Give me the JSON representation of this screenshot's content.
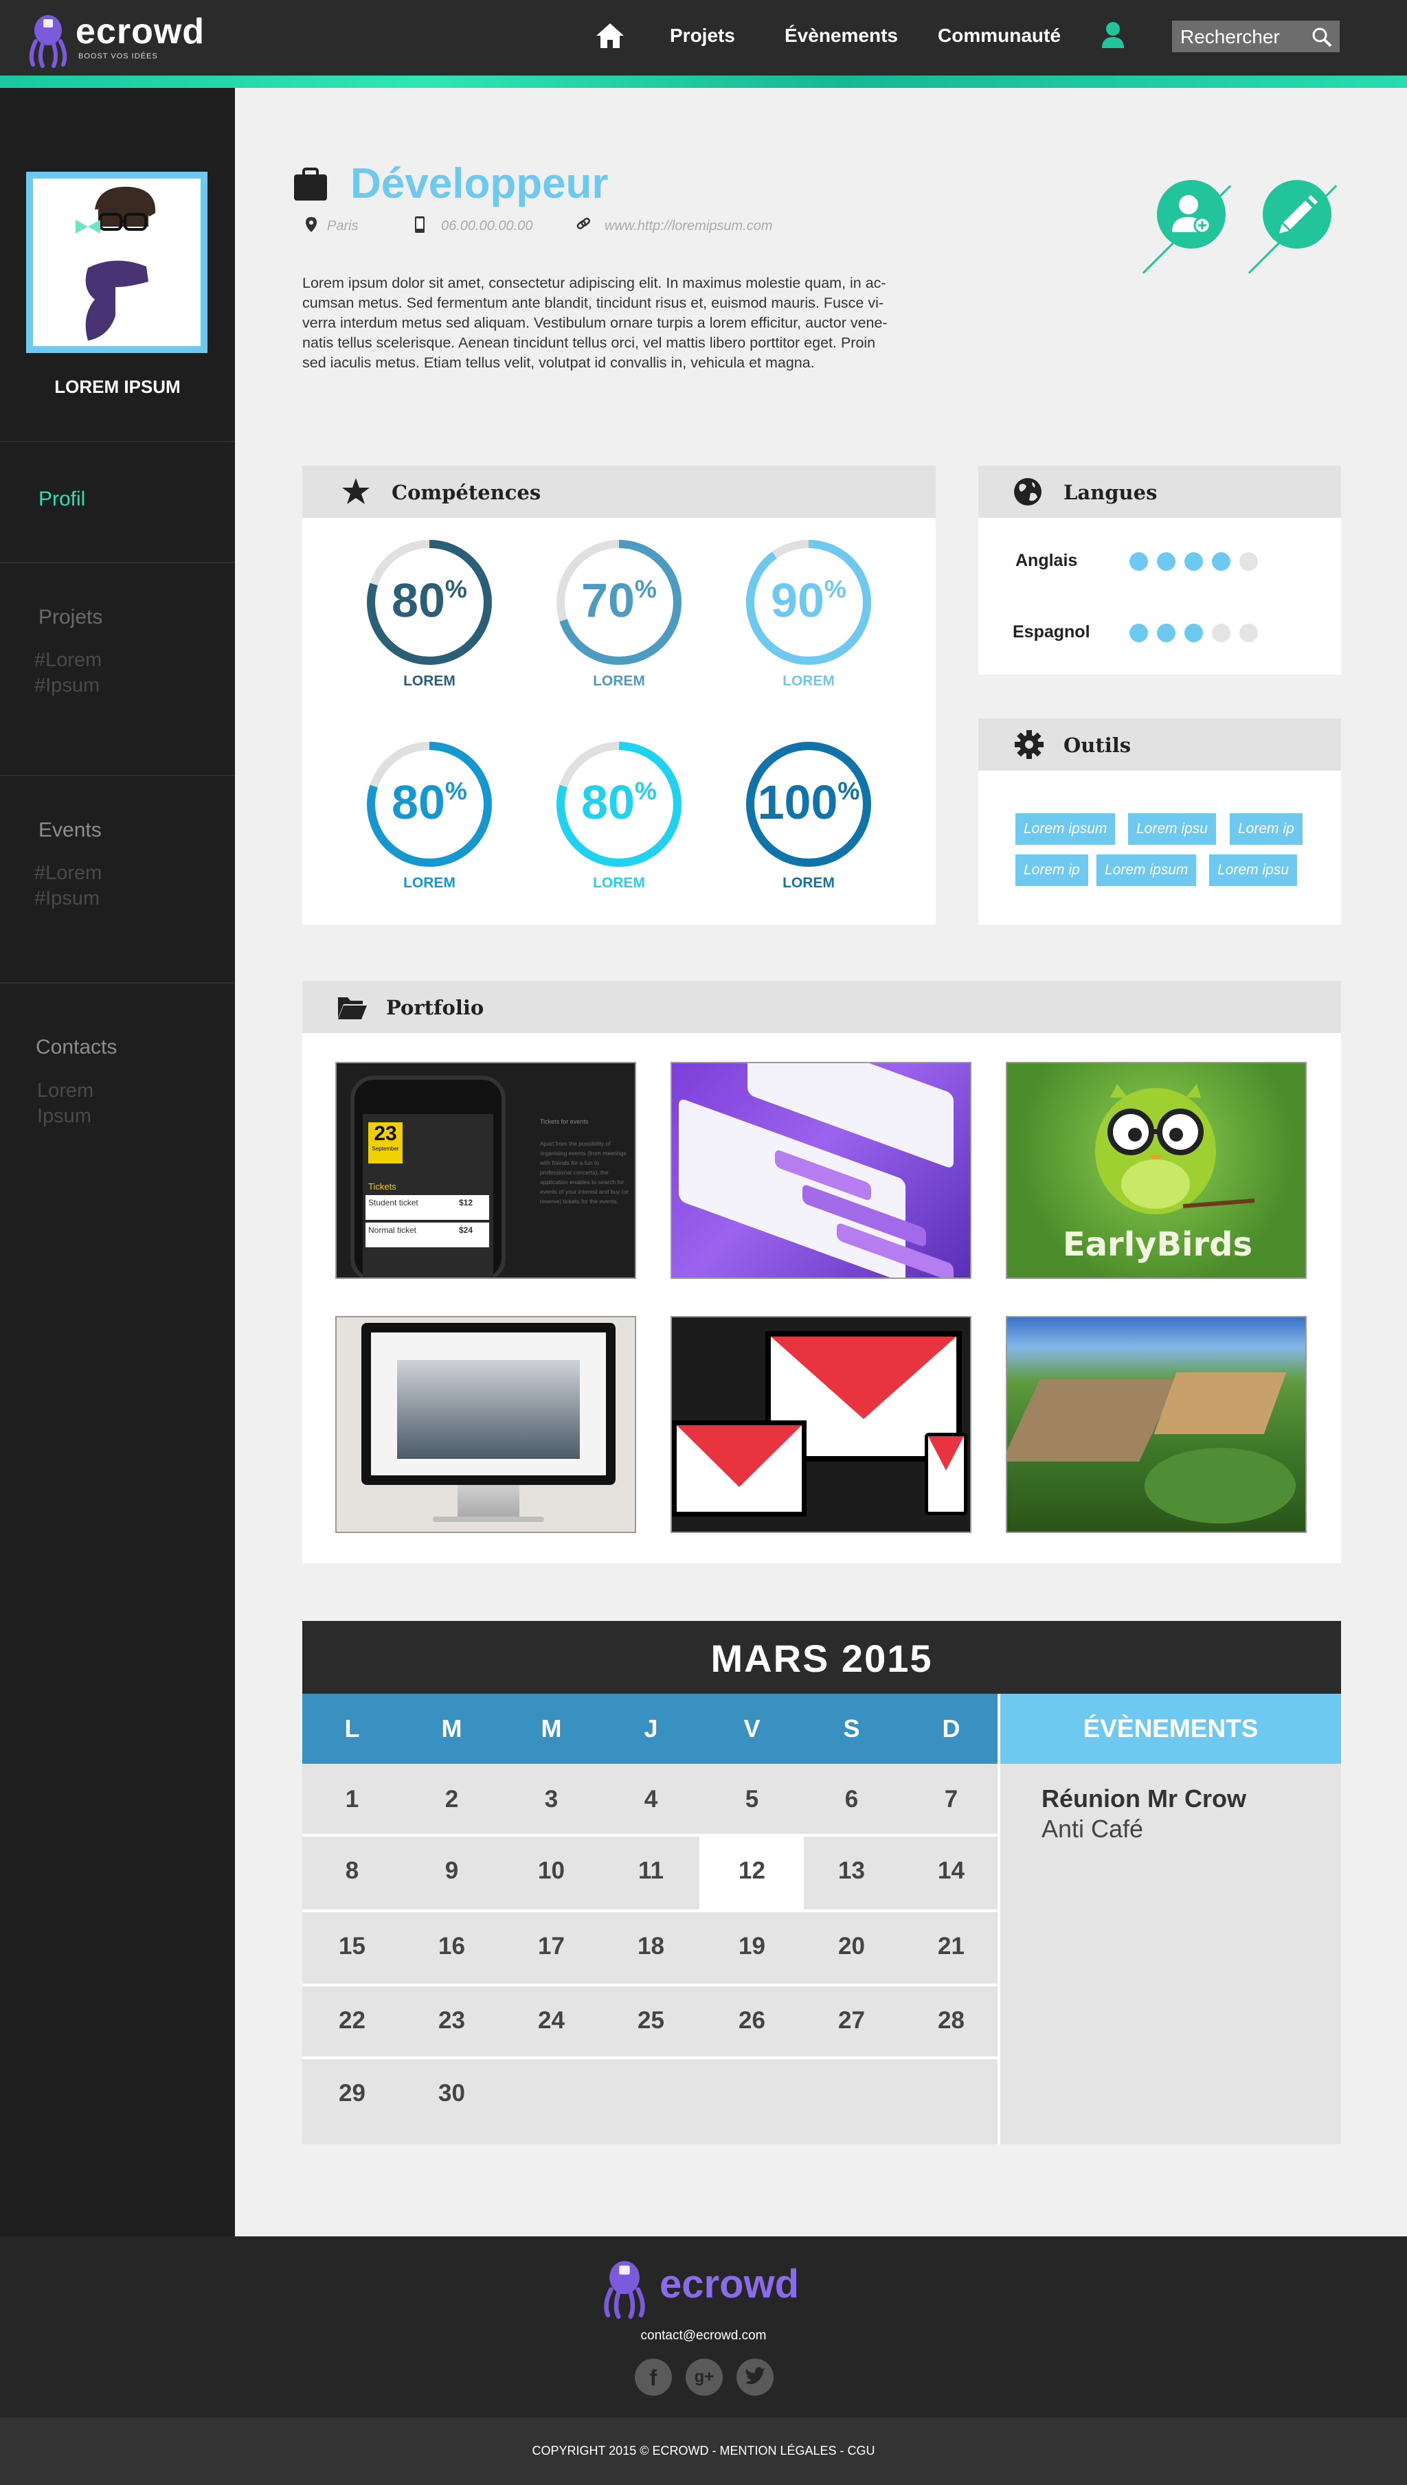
{
  "header": {
    "logo_text": "ecrowd",
    "logo_tagline": "BOOST VOS IDÉES",
    "nav": [
      "Projets",
      "Évènements",
      "Communauté"
    ],
    "search_placeholder": "Rechercher",
    "accent_color": "#21c49b"
  },
  "sidebar": {
    "name": "LOREM IPSUM",
    "profil": "Profil",
    "projets": "Projets",
    "projets_tags": [
      "#Lorem",
      "#Ipsum"
    ],
    "events": "Events",
    "events_tags": [
      "#Lorem",
      "#Ipsum"
    ],
    "contacts": "Contacts",
    "contacts_sub": [
      "Lorem",
      "Ipsum"
    ]
  },
  "profile": {
    "title": "Développeur",
    "location": "Paris",
    "phone": "06.00.00.00.00",
    "website": "www.http://loremipsum.com",
    "bio_lines": [
      "Lorem ipsum dolor sit amet, consectetur adipiscing elit. In maximus molestie quam, in ac-",
      "cumsan metus. Sed fermentum ante blandit, tincidunt risus et, euismod mauris. Fusce vi-",
      "verra interdum metus sed aliquam. Vestibulum ornare turpis a lorem efficitur, auctor vene-",
      "natis tellus scelerisque. Aenean tincidunt tellus orci, vel mattis libero porttitor eget. Proin",
      "sed iaculis metus. Etiam tellus velit, volutpat id convallis in, vehicula et magna."
    ]
  },
  "competences": {
    "title": "Compétences",
    "items": [
      {
        "value": 80,
        "label": "LOREM",
        "color": "#2b5f78"
      },
      {
        "value": 70,
        "label": "LOREM",
        "color": "#4c9bc0"
      },
      {
        "value": 90,
        "label": "LOREM",
        "color": "#6ec9f1"
      },
      {
        "value": 80,
        "label": "LOREM",
        "color": "#1597d0"
      },
      {
        "value": 80,
        "label": "LOREM",
        "color": "#1fd2ef"
      },
      {
        "value": 100,
        "label": "LOREM",
        "color": "#1073aa"
      }
    ],
    "unit": "%"
  },
  "langues": {
    "title": "Langues",
    "items": [
      {
        "name": "Anglais",
        "level": 4,
        "max": 5
      },
      {
        "name": "Espagnol",
        "level": 3,
        "max": 5
      }
    ]
  },
  "outils": {
    "title": "Outils",
    "tags": [
      "Lorem ipsum",
      "Lorem ipsu",
      "Lorem ip",
      "Lorem ip",
      "Lorem ipsum",
      "Lorem ipsu"
    ]
  },
  "portfolio": {
    "title": "Portfolio",
    "early_birds": "EarlyBirds",
    "phone_date": "23",
    "phone_month": "September",
    "phone_tickets": "Tickets",
    "phone_student": "Student ticket",
    "phone_normal": "Normal ticket",
    "phone_price1": "$12",
    "phone_price2": "$24",
    "phone_heading": "Tickets for events",
    "phone_text": "Apart from the possibility of organising events (from meetings with friends for a fun to professional concerts), the application enables to search for events of your interest and buy (or reserve) tickets for the events."
  },
  "calendar": {
    "title": "MARS 2015",
    "day_heads": [
      "L",
      "M",
      "M",
      "J",
      "V",
      "S",
      "D"
    ],
    "weeks": [
      [
        "1",
        "2",
        "3",
        "4",
        "5",
        "6",
        "7"
      ],
      [
        "8",
        "9",
        "10",
        "11",
        "12",
        "13",
        "14"
      ],
      [
        "15",
        "16",
        "17",
        "18",
        "19",
        "20",
        "21"
      ],
      [
        "22",
        "23",
        "24",
        "25",
        "26",
        "27",
        "28"
      ],
      [
        "29",
        "30",
        "",
        "",
        "",
        "",
        ""
      ]
    ],
    "today": "12",
    "events_title": "ÉVÈNEMENTS",
    "event_name": "Réunion Mr Crow",
    "event_place": "Anti Café"
  },
  "footer": {
    "logo_text": "ecrowd",
    "email": "contact@ecrowd.com",
    "social": [
      "facebook-icon",
      "google-plus-icon",
      "twitter-icon"
    ],
    "copyright": "COPYRIGHT 2015 © ECROWD - MENTION LÉGALES - CGU"
  }
}
